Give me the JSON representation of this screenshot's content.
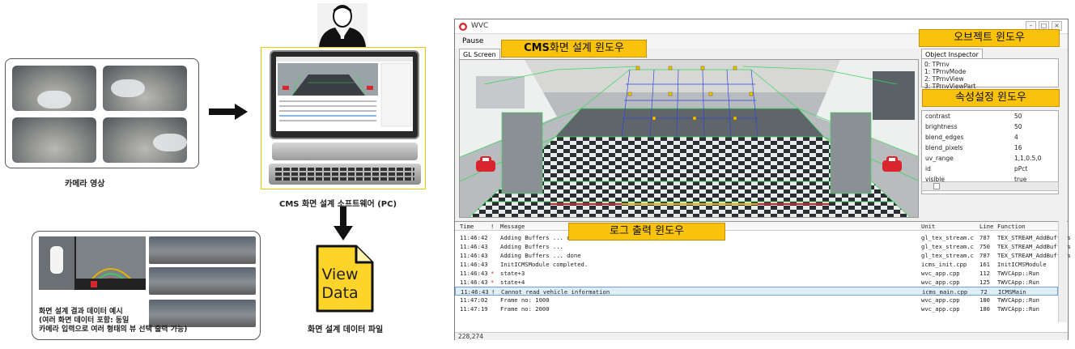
{
  "diagram": {
    "camera_label": "카메라 영상",
    "pc_label": "CMS 화면 설계 소프트웨어 (PC)",
    "file_icon_text_1": "View",
    "file_icon_text_2": "Data",
    "file_label": "화면 설계 데이터 파일",
    "view_desc_1": "화면 설계 결과 데이터 예시",
    "view_desc_2": "(여러 화면 데이터 포함: 동일",
    "view_desc_3": "카메라 입력으로 여러 형태의 뷰 선택 출력 가능)"
  },
  "window": {
    "title": "WVC",
    "pause": "Pause",
    "gl_tab": "GL Screen",
    "object_tab": "Object Inspector",
    "objects": [
      "0: TPrnv",
      "1: TPrnvMode",
      "2: TPrnvView",
      "3: TPrnvViewPart"
    ],
    "properties": [
      {
        "name": "contrast",
        "value": "50"
      },
      {
        "name": "brightness",
        "value": "50"
      },
      {
        "name": "blend_edges",
        "value": "4"
      },
      {
        "name": "blend_pixels",
        "value": "16"
      },
      {
        "name": "uv_range",
        "value": "1,1,0.5,0"
      },
      {
        "name": "id",
        "value": "pPct"
      },
      {
        "name": "visible",
        "value": "true"
      }
    ],
    "log_headers": {
      "time": "Time",
      "flag": "!",
      "message": "Message",
      "unit": "Unit",
      "line": "Line",
      "function": "Function"
    },
    "log_rows": [
      {
        "time": "11:46:42",
        "flag": "",
        "message": "Adding Buffers ... done",
        "unit": "gl_tex_stream.c",
        "line": "787",
        "function": "TEX_STREAM_AddBuffers"
      },
      {
        "time": "11:46:43",
        "flag": "",
        "message": "Adding Buffers ...",
        "unit": "gl_tex_stream.c",
        "line": "750",
        "function": "TEX_STREAM_AddBuffers"
      },
      {
        "time": "11:46:43",
        "flag": "",
        "message": "Adding Buffers ... done",
        "unit": "gl_tex_stream.c",
        "line": "787",
        "function": "TEX_STREAM_AddBuffers"
      },
      {
        "time": "11:46:43",
        "flag": "",
        "message": "InitICMSModule completed.",
        "unit": "icms_init.cpp",
        "line": "161",
        "function": "InitICMSModule"
      },
      {
        "time": "11:46:43",
        "flag": "*",
        "message": "state+3",
        "unit": "wvc_app.cpp",
        "line": "112",
        "function": "TWVCApp::Run"
      },
      {
        "time": "11:46:43",
        "flag": "*",
        "message": "state+4",
        "unit": "wvc_app.cpp",
        "line": "125",
        "function": "TWVCApp::Run"
      },
      {
        "time": "11:46:43",
        "flag": "!",
        "message": "Cannot read vehicle information",
        "unit": "icms_main.cpp",
        "line": "72",
        "function": "ICMSMain"
      },
      {
        "time": "11:47:02",
        "flag": "",
        "message": "Frame no: 1000",
        "unit": "wvc_app.cpp",
        "line": "180",
        "function": "TWVCApp::Run"
      },
      {
        "time": "11:47:19",
        "flag": "",
        "message": "Frame no: 2000",
        "unit": "wvc_app.cpp",
        "line": "180",
        "function": "TWVCApp::Run"
      }
    ],
    "status": "228,274"
  },
  "callouts": {
    "cms_prefix": "CMS",
    "cms_rest": "화면 설계 윈도우",
    "object": "오브젝트 윈도우",
    "property": "속성설정 윈도우",
    "log": "로그 출력 윈도우"
  },
  "colors": {
    "callout": "#f9c20c",
    "grid_green": "#39d65a",
    "checker_dark": "#2a2e33",
    "car_red": "#d9262c"
  }
}
